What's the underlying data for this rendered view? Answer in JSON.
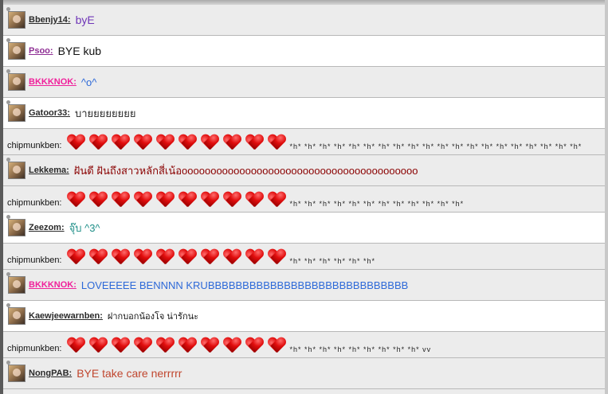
{
  "rows": [
    {
      "type": "user",
      "name": "Bbenjy14:",
      "name_color": "#2a2a2a",
      "message": "byE",
      "message_color": "#6f36b7",
      "message_size": 14,
      "shade": "odd"
    },
    {
      "type": "user",
      "name": "Psoo:",
      "name_color": "#8f2f95",
      "message": "BYE  kub",
      "message_color": "#111111",
      "message_size": 14,
      "shade": "even"
    },
    {
      "type": "user",
      "name": "BKKKNOK:",
      "name_color": "#f0209b",
      "message": "^o^",
      "message_color": "#2d69d8",
      "message_size": 13,
      "shade": "odd"
    },
    {
      "type": "user",
      "name": "Gatoor33:",
      "name_color": "#2a2a2a",
      "message": "บายยยยยยยย",
      "message_color": "#2a2a2a",
      "message_size": 13,
      "shade": "even"
    },
    {
      "type": "hearts",
      "name": "chipmunkben:",
      "tail": "*h* *h* *h* *h* *h* *h* *h* *h* *h* *h* *h* *h* *h* *h* *h* *h* *h* *h* *h* *h*"
    },
    {
      "type": "user",
      "name": "Lekkema:",
      "name_color": "#2a2a2a",
      "message": "ฝันดี ฝันถึงสาวหลักสี่เน้อooooooooooooooooooooooooooooooooooooooooo",
      "message_color": "#8a0000",
      "message_size": 13,
      "shade": "odd"
    },
    {
      "type": "hearts",
      "name": "chipmunkben:",
      "tail": "*h* *h* *h* *h* *h* *h* *h* *h* *h* *h* *h* *h*"
    },
    {
      "type": "user",
      "name": "Zeezom:",
      "name_color": "#2a2a2a",
      "message": "จุ๊บ ^3^",
      "message_color": "#1f8f88",
      "message_size": 13,
      "shade": "even"
    },
    {
      "type": "hearts",
      "name": "chipmunkben:",
      "tail": "*h* *h* *h* *h* *h* *h*"
    },
    {
      "type": "user",
      "name": "BKKKNOK:",
      "name_color": "#f0209b",
      "message": "LOVEEEEE BENNNN KRUBBBBBBBBBBBBBBBBBBBBBBBBBBBBB",
      "message_color": "#2d69d8",
      "message_size": 13,
      "shade": "odd"
    },
    {
      "type": "user",
      "name": "Kaewjeewarnben:",
      "name_color": "#2a2a2a",
      "message": "ฝากบอกน้องโจ น่ารักนะ",
      "message_color": "#111111",
      "message_size": 11,
      "shade": "even"
    },
    {
      "type": "hearts",
      "name": "chipmunkben:",
      "tail": "*h* *h* *h* *h* *h* *h* *h* *h* *h* vv"
    },
    {
      "type": "user",
      "name": "NongPAB:",
      "name_color": "#2a2a2a",
      "message": "BYE take care nerrrrr",
      "message_color": "#c0462e",
      "message_size": 14,
      "shade": "odd"
    }
  ]
}
